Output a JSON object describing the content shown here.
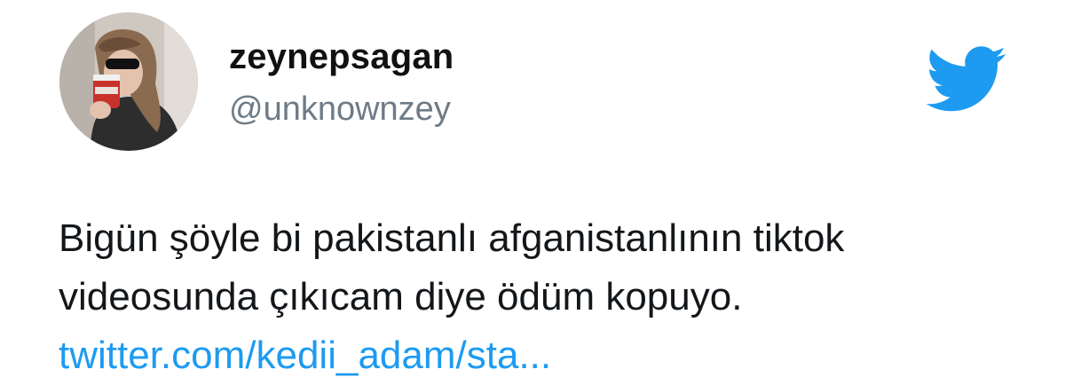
{
  "tweet": {
    "author": {
      "display_name": "zeynepsagan",
      "handle": "@unknownzey"
    },
    "text_lines": [
      "Bigün şöyle bi pakistanlı afganistanlının tiktok",
      "videosunda çıkıcam diye ödüm kopuyo."
    ],
    "link_text": "twitter.com/kedii_adam/sta...",
    "icons": {
      "logo": "twitter-bird-icon"
    },
    "colors": {
      "link": "#1d9bf0",
      "brand": "#1d9bf0",
      "handle": "#6e7b86"
    }
  }
}
